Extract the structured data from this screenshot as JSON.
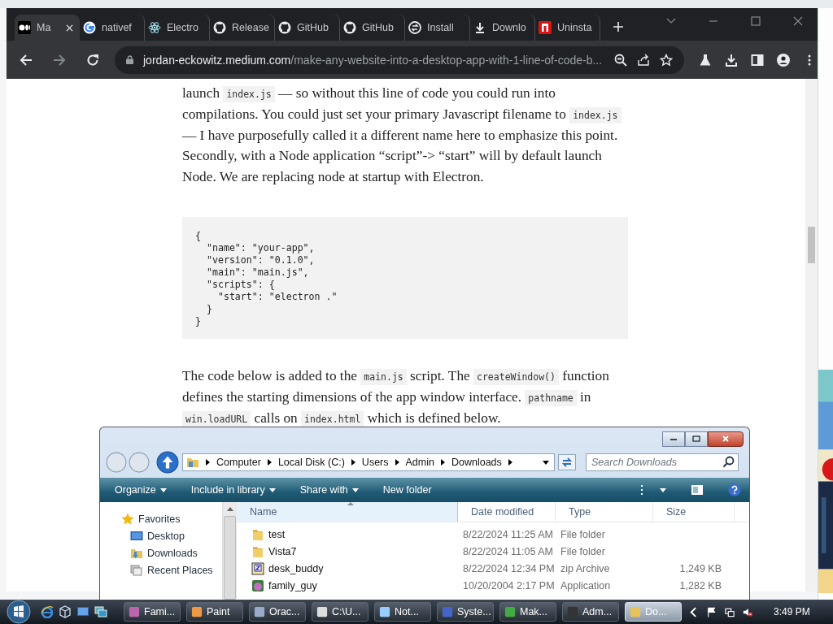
{
  "browser": {
    "tabs": [
      {
        "label": "Ma",
        "kind": "medium",
        "selected": true
      },
      {
        "label": "nativef",
        "kind": "google",
        "selected": false
      },
      {
        "label": "Electro",
        "kind": "electron",
        "selected": false
      },
      {
        "label": "Release",
        "kind": "github",
        "selected": false
      },
      {
        "label": "GitHub",
        "kind": "github",
        "selected": false
      },
      {
        "label": "GitHub",
        "kind": "github",
        "selected": false
      },
      {
        "label": "Install",
        "kind": "reload",
        "selected": false
      },
      {
        "label": "Downlo",
        "kind": "download",
        "selected": false
      },
      {
        "label": "Uninsta",
        "kind": "red",
        "selected": false
      }
    ],
    "address": {
      "domain": "jordan-eckowitz.medium.com",
      "path": "/make-any-website-into-a-desktop-app-with-1-line-of-code-b..."
    }
  },
  "article": {
    "paragraphs": [
      [
        {
          "text": "launch ",
          "code": false
        },
        {
          "text": "index.js",
          "code": true
        },
        {
          "text": " — so without this line of code you could run into compilations. You could just set your primary Javascript filename to ",
          "code": false
        },
        {
          "text": "index.js",
          "code": true
        },
        {
          "text": " — I have purposefully called it a different name here to emphasize this point. Secondly, with a Node application “script”-> “start” will by default launch Node. We are replacing node at startup with Electron.",
          "code": false
        }
      ],
      [
        {
          "text": "The code below is added to the ",
          "code": false
        },
        {
          "text": "main.js",
          "code": true
        },
        {
          "text": " script. The ",
          "code": false
        },
        {
          "text": "createWindow()",
          "code": true
        },
        {
          "text": " function defines the starting dimensions of the app window interface. ",
          "code": false
        },
        {
          "text": "pathname",
          "code": true
        },
        {
          "text": " in ",
          "code": false
        },
        {
          "text": "win.loadURL",
          "code": true
        },
        {
          "text": " calls on ",
          "code": false
        },
        {
          "text": "index.html",
          "code": true
        },
        {
          "text": " which is defined below.",
          "code": false
        }
      ]
    ],
    "code_lines": [
      "{",
      "  \"name\": \"your-app\",",
      "  \"version\": \"0.1.0\",",
      "  \"main\": \"main.js\",",
      "  \"scripts\": {",
      "    \"start\": \"electron .\"",
      "  }",
      "}"
    ]
  },
  "explorer": {
    "breadcrumb": [
      "Computer",
      "Local Disk (C:)",
      "Users",
      "Admin",
      "Downloads"
    ],
    "search": {
      "placeholder": "Search Downloads"
    },
    "commands": [
      {
        "label": "Organize",
        "dropdown": true
      },
      {
        "label": "Include in library",
        "dropdown": true
      },
      {
        "label": "Share with",
        "dropdown": true
      },
      {
        "label": "New folder",
        "dropdown": false
      }
    ],
    "nav": {
      "header": "Favorites",
      "items": [
        {
          "label": "Desktop",
          "kind": "desktop"
        },
        {
          "label": "Downloads",
          "kind": "downloads"
        },
        {
          "label": "Recent Places",
          "kind": "recent"
        }
      ]
    },
    "columns": [
      "Name",
      "Date modified",
      "Type",
      "Size"
    ],
    "files": [
      {
        "name": "test",
        "kind": "folder",
        "date": "8/22/2024 11:25 AM",
        "type": "File folder"
      },
      {
        "name": "Vista7",
        "kind": "folder",
        "date": "8/22/2024 11:05 AM",
        "type": "File folder"
      },
      {
        "name": "desk_buddy",
        "kind": "zip",
        "date": "8/22/2024 12:34 PM",
        "type": "zip Archive",
        "size": "1,249 KB"
      },
      {
        "name": "family_guy",
        "kind": "app",
        "date": "10/20/2004 2:17 PM",
        "type": "Application",
        "size": "1,282 KB"
      }
    ]
  },
  "taskbar": {
    "tasks": [
      {
        "label": "Fami...",
        "kind": "app",
        "selected": false
      },
      {
        "label": "Paint",
        "kind": "paint",
        "selected": false
      },
      {
        "label": "Orac...",
        "kind": "box",
        "selected": false
      },
      {
        "label": "C:\\U...",
        "kind": "zip",
        "selected": false
      },
      {
        "label": "Not...",
        "kind": "notepad",
        "selected": false
      },
      {
        "label": "Syste...",
        "kind": "monitor",
        "selected": false
      },
      {
        "label": "Mak...",
        "kind": "chrome",
        "selected": false
      },
      {
        "label": "Adm...",
        "kind": "console",
        "selected": false
      },
      {
        "label": "Do...",
        "kind": "folder",
        "selected": true
      }
    ],
    "clock": "3:49 PM"
  }
}
